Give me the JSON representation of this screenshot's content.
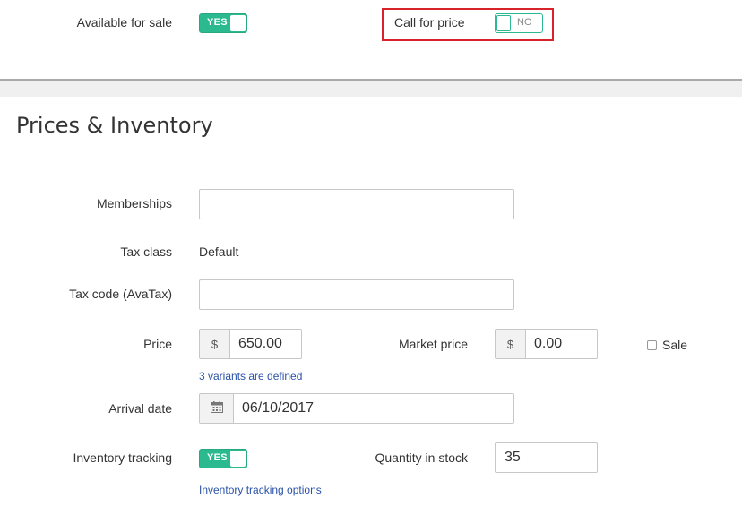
{
  "top": {
    "available_label": "Available for sale",
    "available_toggle": "YES",
    "call_label": "Call for price",
    "call_toggle": "NO"
  },
  "section": {
    "title": "Prices & Inventory"
  },
  "form": {
    "memberships_label": "Memberships",
    "memberships_value": "",
    "tax_class_label": "Tax class",
    "tax_class_value": "Default",
    "tax_code_label": "Tax code (AvaTax)",
    "tax_code_value": "",
    "price_label": "Price",
    "price_currency": "$",
    "price_value": "650.00",
    "variants_link": "3 variants are defined",
    "market_price_label": "Market price",
    "market_currency": "$",
    "market_value": "0.00",
    "sale_label": "Sale",
    "arrival_label": "Arrival date",
    "arrival_value": "06/10/2017",
    "inventory_label": "Inventory tracking",
    "inventory_toggle": "YES",
    "inventory_link": "Inventory tracking options",
    "quantity_label": "Quantity in stock",
    "quantity_value": "35"
  },
  "colors": {
    "toggle_green": "#2bba8f",
    "highlight_red": "#d8232a",
    "link_blue": "#2a52a8"
  },
  "icons": {
    "calendar": "calendar-icon"
  }
}
